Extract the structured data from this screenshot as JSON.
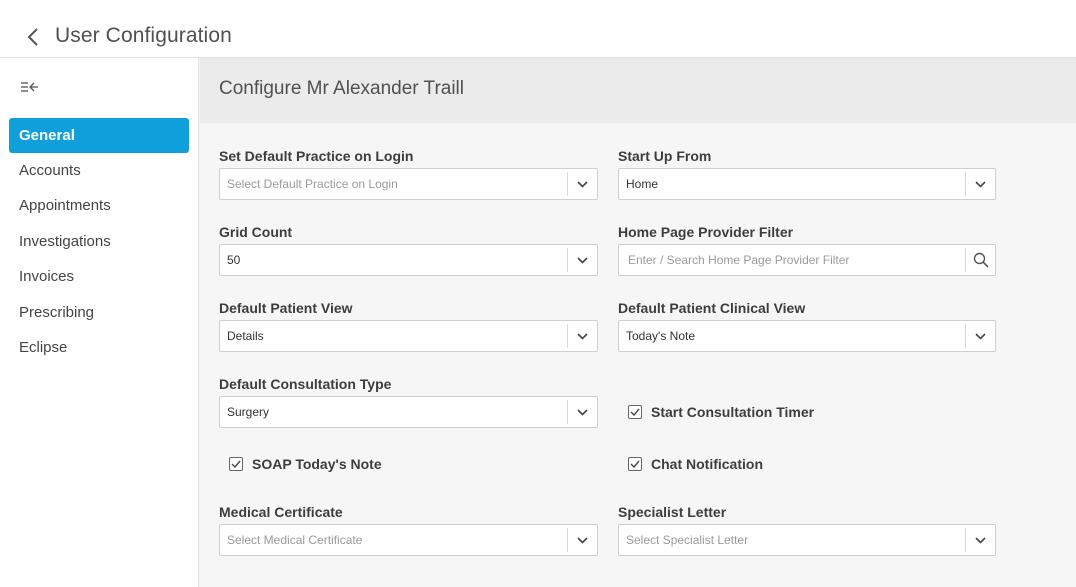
{
  "header": {
    "title": "User Configuration"
  },
  "sidebar": {
    "items": [
      {
        "label": "General",
        "active": true
      },
      {
        "label": "Accounts"
      },
      {
        "label": "Appointments"
      },
      {
        "label": "Investigations"
      },
      {
        "label": "Invoices"
      },
      {
        "label": "Prescribing"
      },
      {
        "label": "Eclipse"
      }
    ]
  },
  "main": {
    "title": "Configure Mr Alexander Traill",
    "default_practice": {
      "label": "Set Default Practice on Login",
      "placeholder": "Select Default Practice on Login"
    },
    "start_up_from": {
      "label": "Start Up From",
      "value": "Home"
    },
    "grid_count": {
      "label": "Grid Count",
      "value": "50"
    },
    "provider_filter": {
      "label": "Home Page Provider Filter",
      "placeholder": "Enter / Search Home Page Provider Filter"
    },
    "patient_view": {
      "label": "Default Patient View",
      "value": "Details"
    },
    "clinical_view": {
      "label": "Default Patient Clinical View",
      "value": "Today's Note"
    },
    "consultation_type": {
      "label": "Default Consultation Type",
      "value": "Surgery"
    },
    "start_timer": {
      "label": "Start Consultation Timer",
      "checked": true
    },
    "soap_note": {
      "label": "SOAP Today's Note",
      "checked": true
    },
    "chat_notification": {
      "label": "Chat Notification",
      "checked": true
    },
    "medical_certificate": {
      "label": "Medical Certificate",
      "placeholder": "Select Medical Certificate"
    },
    "specialist_letter": {
      "label": "Specialist Letter",
      "placeholder": "Select Specialist Letter"
    }
  },
  "colors": {
    "accent": "#0fa0dc",
    "header_bg": "#ebebeb",
    "page_bg": "#f6f6f6"
  }
}
